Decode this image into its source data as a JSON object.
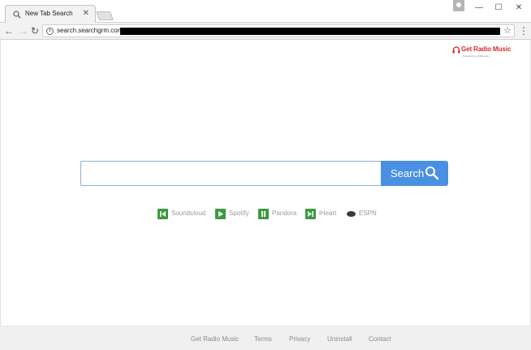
{
  "tab": {
    "title": "New Tab Search",
    "close_glyph": "✕",
    "icon": "search-icon"
  },
  "window": {
    "min_glyph": "—",
    "max_glyph": "☐",
    "close_glyph": "✕"
  },
  "toolbar": {
    "back_glyph": "←",
    "forward_glyph": "→",
    "reload_glyph": "↻",
    "info_glyph": "i",
    "url": "search.searchgrm.com",
    "star_glyph": "☆",
    "menu_glyph": "⋮"
  },
  "brand": {
    "name": "Get Radio Music",
    "subtitle": "Powered by InfoBrowser",
    "accent": "#d42b2b"
  },
  "search": {
    "placeholder": "",
    "value": "",
    "button_label": "Search",
    "button_color": "#4a90e2"
  },
  "quick_links": [
    {
      "label": "Soundcloud",
      "icon": "skip-back-icon"
    },
    {
      "label": "Spotify",
      "icon": "play-icon"
    },
    {
      "label": "Pandora",
      "icon": "pause-icon"
    },
    {
      "label": "iHeart",
      "icon": "skip-forward-icon"
    },
    {
      "label": "ESPN",
      "icon": "espn-logo-icon"
    }
  ],
  "footer": {
    "links": [
      "Get Radio Music",
      "Terms",
      "Privacy",
      "Uninstall",
      "Contact"
    ]
  }
}
